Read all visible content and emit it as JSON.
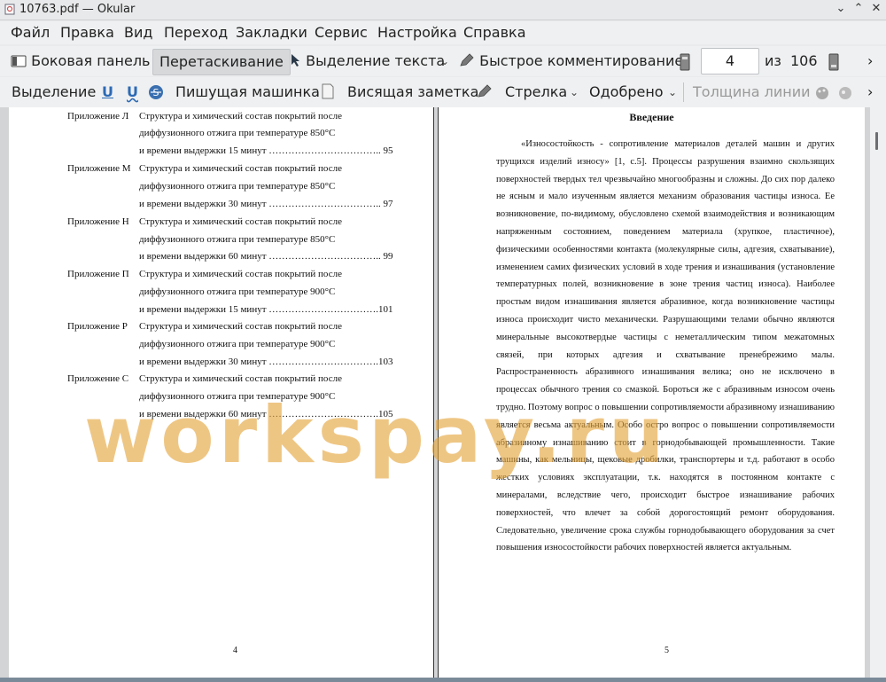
{
  "window": {
    "title": "10763.pdf  — Okular"
  },
  "menu": [
    "Файл",
    "Правка",
    "Вид",
    "Переход",
    "Закладки",
    "Сервис",
    "Настройка",
    "Справка"
  ],
  "toolbar1": {
    "sidebar": "Боковая панель",
    "drag": "Перетаскивание",
    "select_text": "Выделение текста",
    "quick_comment": "Быстрое комментирование",
    "page_current": "4",
    "page_of": "из",
    "page_total": "106"
  },
  "toolbar2": {
    "selection": "Выделение",
    "typewriter": "Пишущая машинка",
    "note": "Висящая заметка",
    "arrow": "Стрелка",
    "approved": "Одобрено",
    "line_width": "Толщина линии"
  },
  "left_page": {
    "entries": [
      {
        "label": "Приложение Л",
        "l1": "Структура и химический состав покрытий после",
        "l2": "диффузионного отжига при температуре 850°С",
        "l3": "и времени выдержки 15 минут ……………………………..  95"
      },
      {
        "label": "Приложение М",
        "l1": "Структура и химический состав покрытий после",
        "l2": "диффузионного отжига при температуре 850°С",
        "l3": "и времени выдержки 30 минут ……………………………..  97"
      },
      {
        "label": "Приложение Н",
        "l1": "Структура и химический состав покрытий после",
        "l2": "диффузионного отжига при температуре 850°С",
        "l3": "и времени выдержки 60 минут ……………………………..  99"
      },
      {
        "label": "Приложение П",
        "l1": "Структура и химический состав покрытий после",
        "l2": "диффузионного отжига при температуре 900°С",
        "l3": "и времени выдержки 15 минут …………………………….101"
      },
      {
        "label": "Приложение Р",
        "l1": "Структура и химический состав покрытий после",
        "l2": "диффузионного отжига при температуре 900°С",
        "l3": "и времени выдержки 30 минут …………………………….103"
      },
      {
        "label": "Приложение С",
        "l1": "Структура и химический состав покрытий после",
        "l2": "диффузионного отжига при температуре 900°С",
        "l3": "и времени выдержки 60 минут …………………………….105"
      }
    ],
    "page_number": "4"
  },
  "right_page": {
    "heading": "Введение",
    "paragraph": "«Износостойкость - сопротивление материалов деталей машин и других трущихся изделий износу» [1, с.5]. Процессы разрушения взаимно скользящих поверхностей твердых тел чрезвычайно многообразны и сложны. До сих пор далеко не ясным и мало изученным является механизм образования частицы износа. Ее возникновение, по-видимому, обусловлено схемой взаимодействия и возникающим напряженным состоянием, поведением материала (хрупкое, пластичное), физическими особенностями контакта (молекулярные силы, адгезия, схватывание), изменением самих физических условий в ходе трения и изнашивания (установление температурных полей, возникновение в зоне трения частиц износа). Наиболее простым видом изнашивания является абразивное, когда возникновение частицы износа происходит чисто механически. Разрушающими телами обычно являются минеральные высокотвердые частицы с неметаллическим типом межатомных связей, при которых адгезия и схватывание пренебрежимо малы. Распространенность абразивного изнашивания велика; оно не исключено в процессах обычного трения со смазкой. Бороться же с абразивным износом очень трудно. Поэтому вопрос о повышении сопротивляемости абразивному изнашиванию является весьма актуальным. Особо остро вопрос о повышении сопротивляемости абразивному изнашиванию стоит в горнодобывающей промышленности. Такие машины, как мельницы, щековые дробилки, транспортеры и т.д. работают в особо жестких условиях эксплуатации, т.к. находятся в постоянном контакте с минералами, вследствие чего, происходит быстрое изнашивание рабочих поверхностей, что влечет за собой дорогостоящий ремонт оборудования. Следовательно, увеличение срока службы горнодобывающего оборудования за счет повышения износостойкости рабочих поверхностей является актуальным.",
    "page_number": "5"
  },
  "watermark": "workspay.ru",
  "colors": {
    "watermark": "#e5a43a",
    "toolbar_bg": "#eff0f1",
    "view_bg": "#d3d4d5"
  }
}
